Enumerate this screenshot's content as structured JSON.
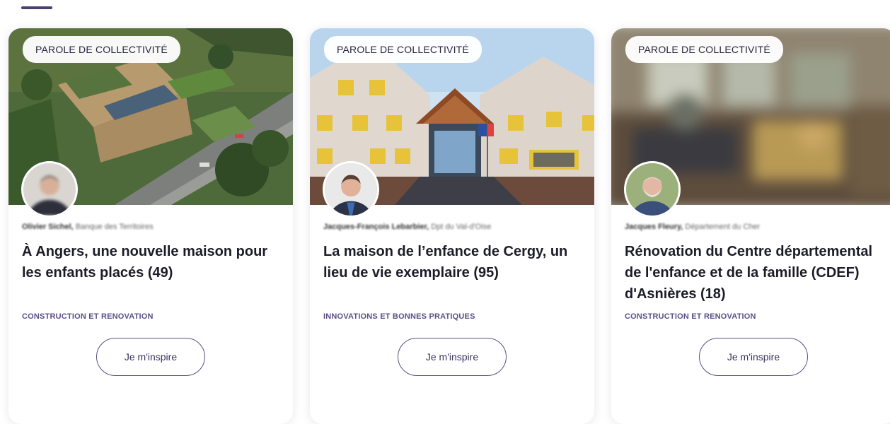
{
  "cards": [
    {
      "badge": "PAROLE DE COLLECTIVITÉ",
      "author_name": "Olivier Sichel,",
      "author_org": "Banque des Territoires",
      "title": "À Angers, une nouvelle maison pour les enfants placés (49)",
      "category": "CONSTRUCTION ET RENOVATION",
      "cta": "Je m'inspire"
    },
    {
      "badge": "PAROLE DE COLLECTIVITÉ",
      "author_name": "Jacques-François Lebarbier,",
      "author_org": "Dpt du Val-d'Oise",
      "title": "La maison de l’enfance de Cergy, un lieu de vie exemplaire (95)",
      "category": "INNOVATIONS ET BONNES PRATIQUES",
      "cta": "Je m'inspire"
    },
    {
      "badge": "PAROLE DE COLLECTIVITÉ",
      "author_name": "Jacques Fleury,",
      "author_org": "Département du Cher",
      "title": "Rénovation du Centre départemental de l'enfance et de la famille (CDEF) d'Asnières (18)",
      "category": "CONSTRUCTION ET RENOVATION",
      "cta": "Je m'inspire"
    }
  ],
  "colors": {
    "accent": "#5a4f86",
    "accent_line": "#4b4070",
    "badge_bg": "#ffffff",
    "text": "#1c1c28"
  }
}
